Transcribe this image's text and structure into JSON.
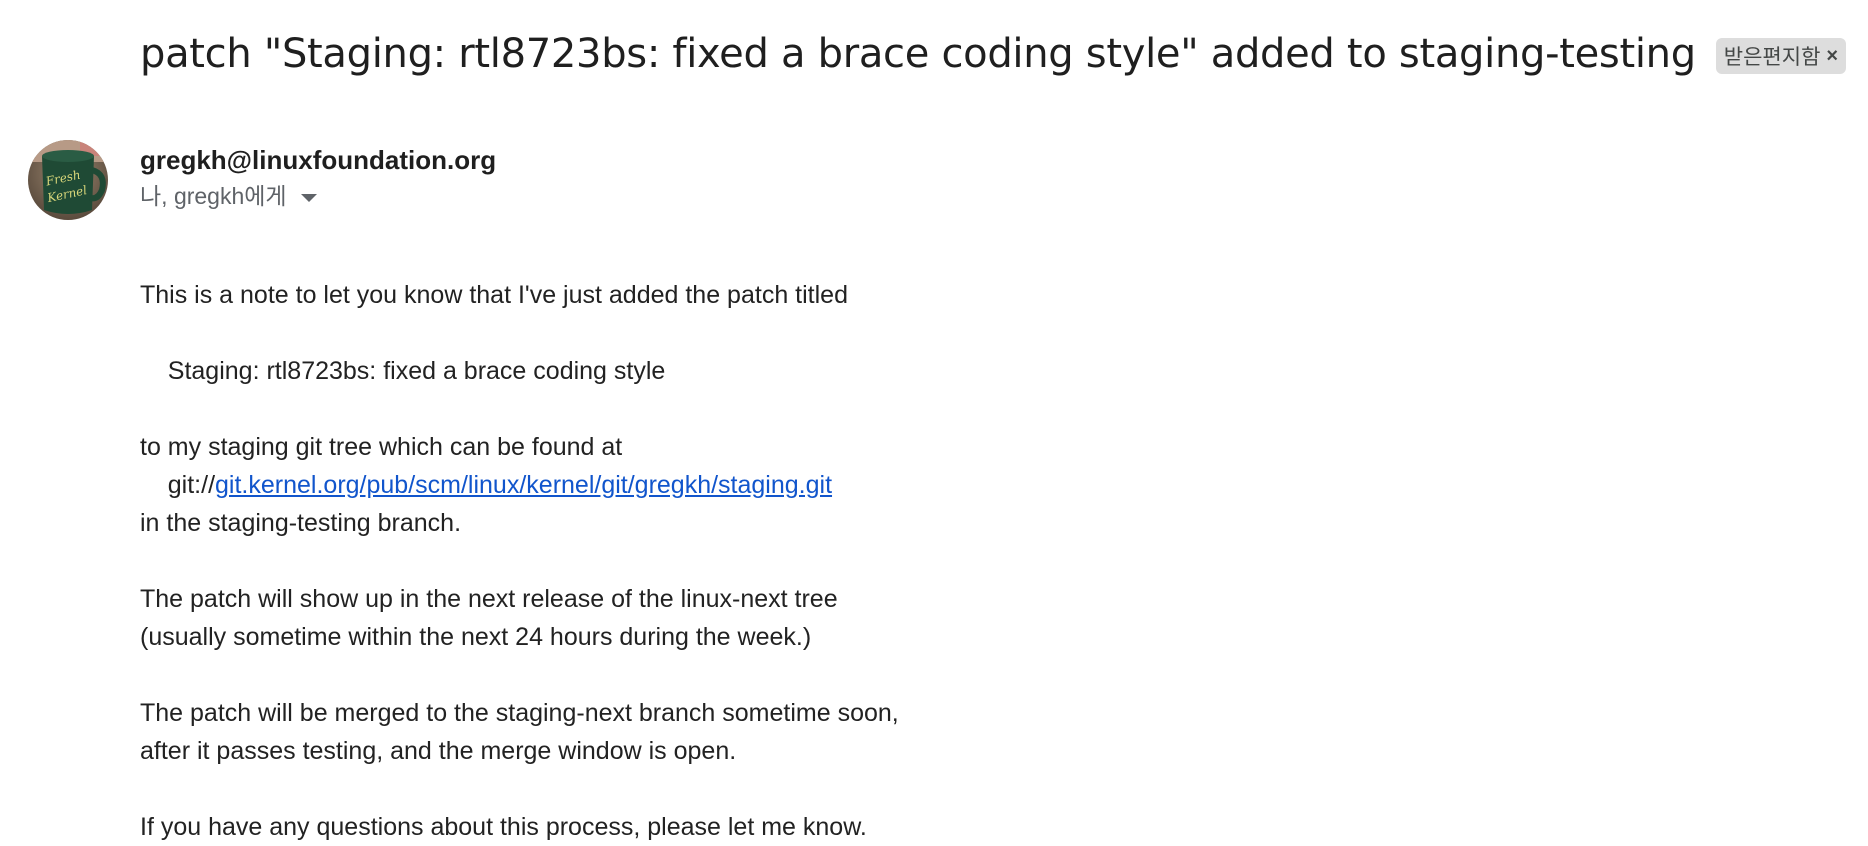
{
  "email": {
    "subject": "patch \"Staging: rtl8723bs: fixed a brace coding style\" added to staging-testing",
    "label": {
      "text": "받은편지함",
      "remove_symbol": "×"
    },
    "sender": {
      "email": "gregkh@linuxfoundation.org",
      "recipients": "나, gregkh에게",
      "avatar_text": [
        "Fresh",
        "Kernel"
      ]
    },
    "body": {
      "line1": "This is a note to let you know that I've just added the patch titled",
      "line2": "    Staging: rtl8723bs: fixed a brace coding style",
      "line3": "to my staging git tree which can be found at",
      "line4_prefix": "    git://",
      "line4_link": "git.kernel.org/pub/scm/linux/kernel/git/gregkh/staging.git",
      "line5": "in the staging-testing branch.",
      "line6": "The patch will show up in the next release of the linux-next tree",
      "line7": "(usually sometime within the next 24 hours during the week.)",
      "line8": "The patch will be merged to the staging-next branch sometime soon,",
      "line9": "after it passes testing, and the merge window is open.",
      "line10": "If you have any questions about this process, please let me know."
    }
  },
  "colors": {
    "link": "#1155cc",
    "chip_bg": "#dddddd",
    "secondary_text": "#5f6368"
  }
}
